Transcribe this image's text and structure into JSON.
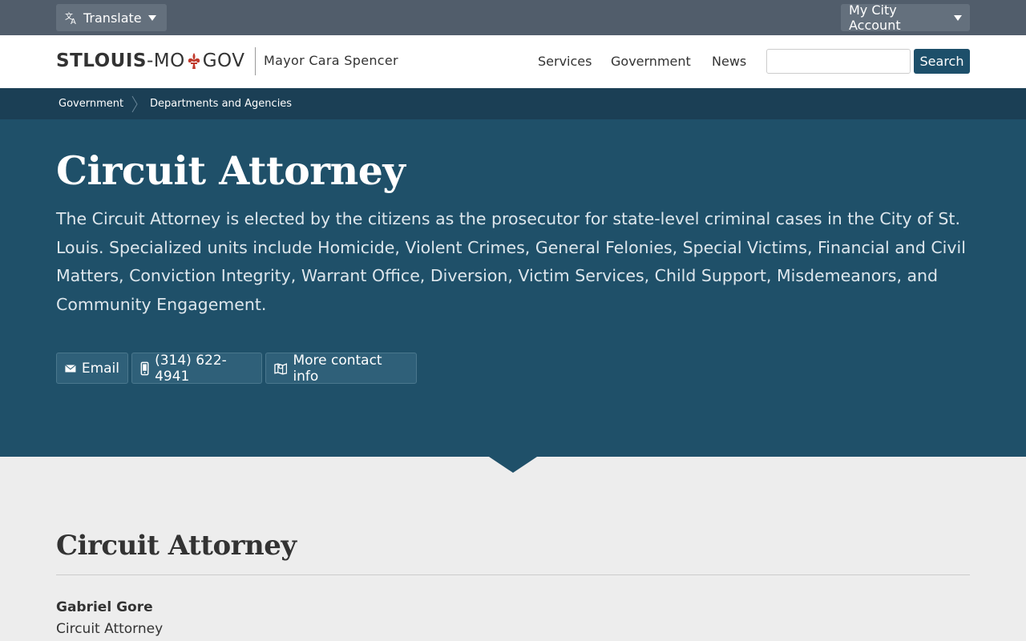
{
  "utility": {
    "translate_label": "Translate",
    "account_label": "My City Account"
  },
  "header": {
    "logo_part1": "STLOUIS",
    "logo_part2": "-MO",
    "logo_part3": "GOV",
    "mayor": "Mayor Cara Spencer",
    "nav": [
      "Services",
      "Government",
      "News"
    ],
    "search_button": "Search",
    "search_value": ""
  },
  "breadcrumb": [
    "Government",
    "Departments and Agencies"
  ],
  "hero": {
    "title": "Circuit Attorney",
    "description": "The Circuit Attorney is elected by the citizens as the prosecutor for state-level criminal cases in the City of St. Louis. Specialized units include Homicide, Violent Crimes, General Felonies, Special Victims, Financial and Civil Matters, Conviction Integrity, Warrant Office, Diversion, Victim Services, Child Support, Misdemeanors, and Community Engagement.",
    "email_label": "Email",
    "phone_label": "(314) 622-4941",
    "contact_label": "More contact info"
  },
  "content": {
    "section_title": "Circuit Attorney",
    "person_name": "Gabriel Gore",
    "person_role": "Circuit Attorney"
  },
  "colors": {
    "utility_bar": "#515d6b",
    "breadcrumb_bar": "#1b3f55",
    "hero_bg": "#1f5069",
    "fleur_red": "#c0392b",
    "search_button": "#1d4f6a"
  }
}
